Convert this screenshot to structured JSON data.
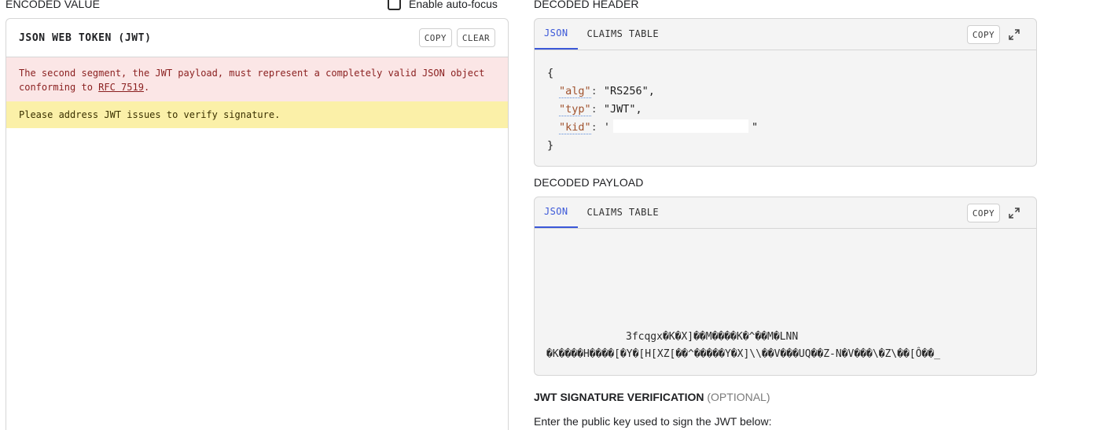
{
  "encoded": {
    "section_title": "ENCODED VALUE",
    "autofocus_label": "Enable auto-focus",
    "panel_title": "JSON WEB TOKEN (JWT)",
    "copy_label": "COPY",
    "clear_label": "CLEAR",
    "error_text_before": "The second segment, the JWT payload, must represent a completely valid JSON object conforming to ",
    "error_link": "RFC 7519",
    "error_text_after": ".",
    "warning_text": "Please address JWT issues to verify signature."
  },
  "decoded_header": {
    "section_title": "DECODED HEADER",
    "tabs": [
      {
        "label": "JSON",
        "active": true
      },
      {
        "label": "CLAIMS TABLE",
        "active": false
      }
    ],
    "copy_label": "COPY",
    "json": {
      "open": "{",
      "close": "}",
      "alg_key": "\"alg\"",
      "alg_value": "\"RS256\",",
      "typ_key": "\"typ\"",
      "typ_value": "\"JWT\",",
      "kid_key": "\"kid\"",
      "kid_value_open": "'",
      "kid_value_close": "\""
    }
  },
  "decoded_payload": {
    "section_title": "DECODED PAYLOAD",
    "tabs": [
      {
        "label": "JSON",
        "active": true
      },
      {
        "label": "CLAIMS TABLE",
        "active": false
      }
    ],
    "copy_label": "COPY",
    "garbled_line_1": "3fcqgx�K�X]��M����K�^��M�LNN",
    "garbled_line_2": "�K����H����[�Y�[H[XZ[��^�����Y�X]\\\\��V���UQ��Z-N�V���\\�Z\\��[Ô��_"
  },
  "signature": {
    "title": "JWT SIGNATURE VERIFICATION",
    "optional": "(OPTIONAL)",
    "instruction": "Enter the public key used to sign the JWT below:"
  }
}
